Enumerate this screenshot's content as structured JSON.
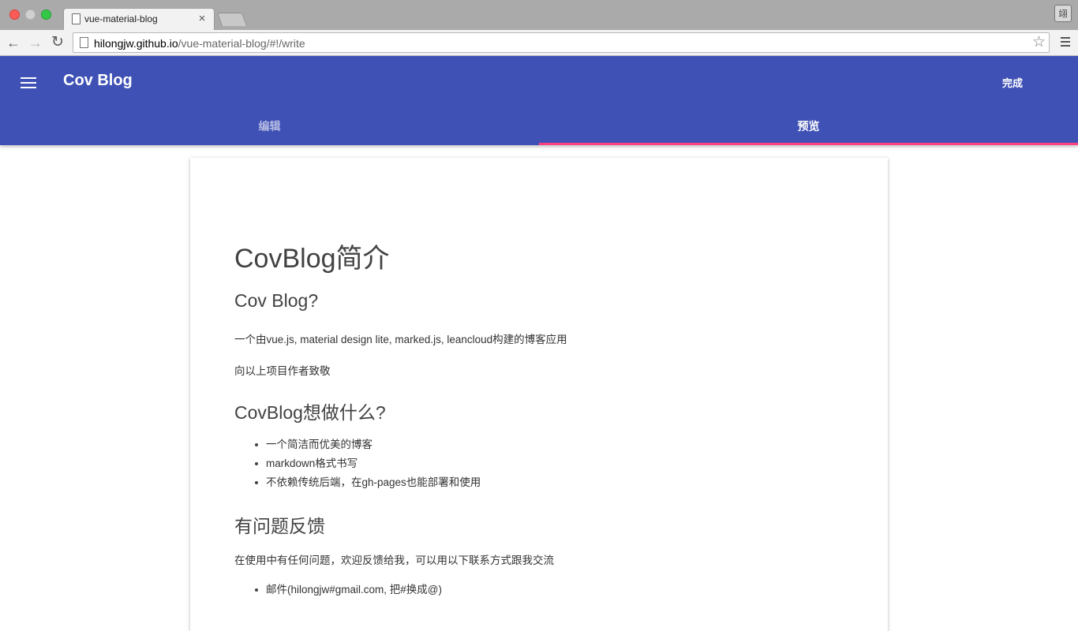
{
  "browser": {
    "tab_title": "vue-material-blog",
    "tab_close": "×",
    "url_host": "hilongjw.github.io",
    "url_path": "/vue-material-blog/#!/write",
    "user_badge": "翊",
    "back_icon": "←",
    "forward_icon": "→",
    "reload_icon": "↻",
    "star_icon": "☆"
  },
  "app": {
    "title": "Cov Blog",
    "done_label": "完成",
    "tabs": [
      {
        "label": "编辑",
        "active": false
      },
      {
        "label": "预览",
        "active": true
      }
    ],
    "colors": {
      "primary": "#3f51b5",
      "accent": "#ff4081"
    }
  },
  "article": {
    "title": "CovBlog简介",
    "section1": {
      "heading": "Cov Blog?",
      "para1": "一个由vue.js, material design lite, marked.js, leancloud构建的博客应用",
      "para2": "向以上项目作者致敬"
    },
    "section2": {
      "heading": "CovBlog想做什么?",
      "items": [
        "一个简洁而优美的博客",
        "markdown格式书写",
        "不依赖传统后端，在gh-pages也能部署和使用"
      ]
    },
    "section3": {
      "heading": "有问题反馈",
      "para": "在使用中有任何问题，欢迎反馈给我，可以用以下联系方式跟我交流",
      "items": [
        "邮件(hilongjw#gmail.com, 把#换成@)"
      ]
    }
  }
}
